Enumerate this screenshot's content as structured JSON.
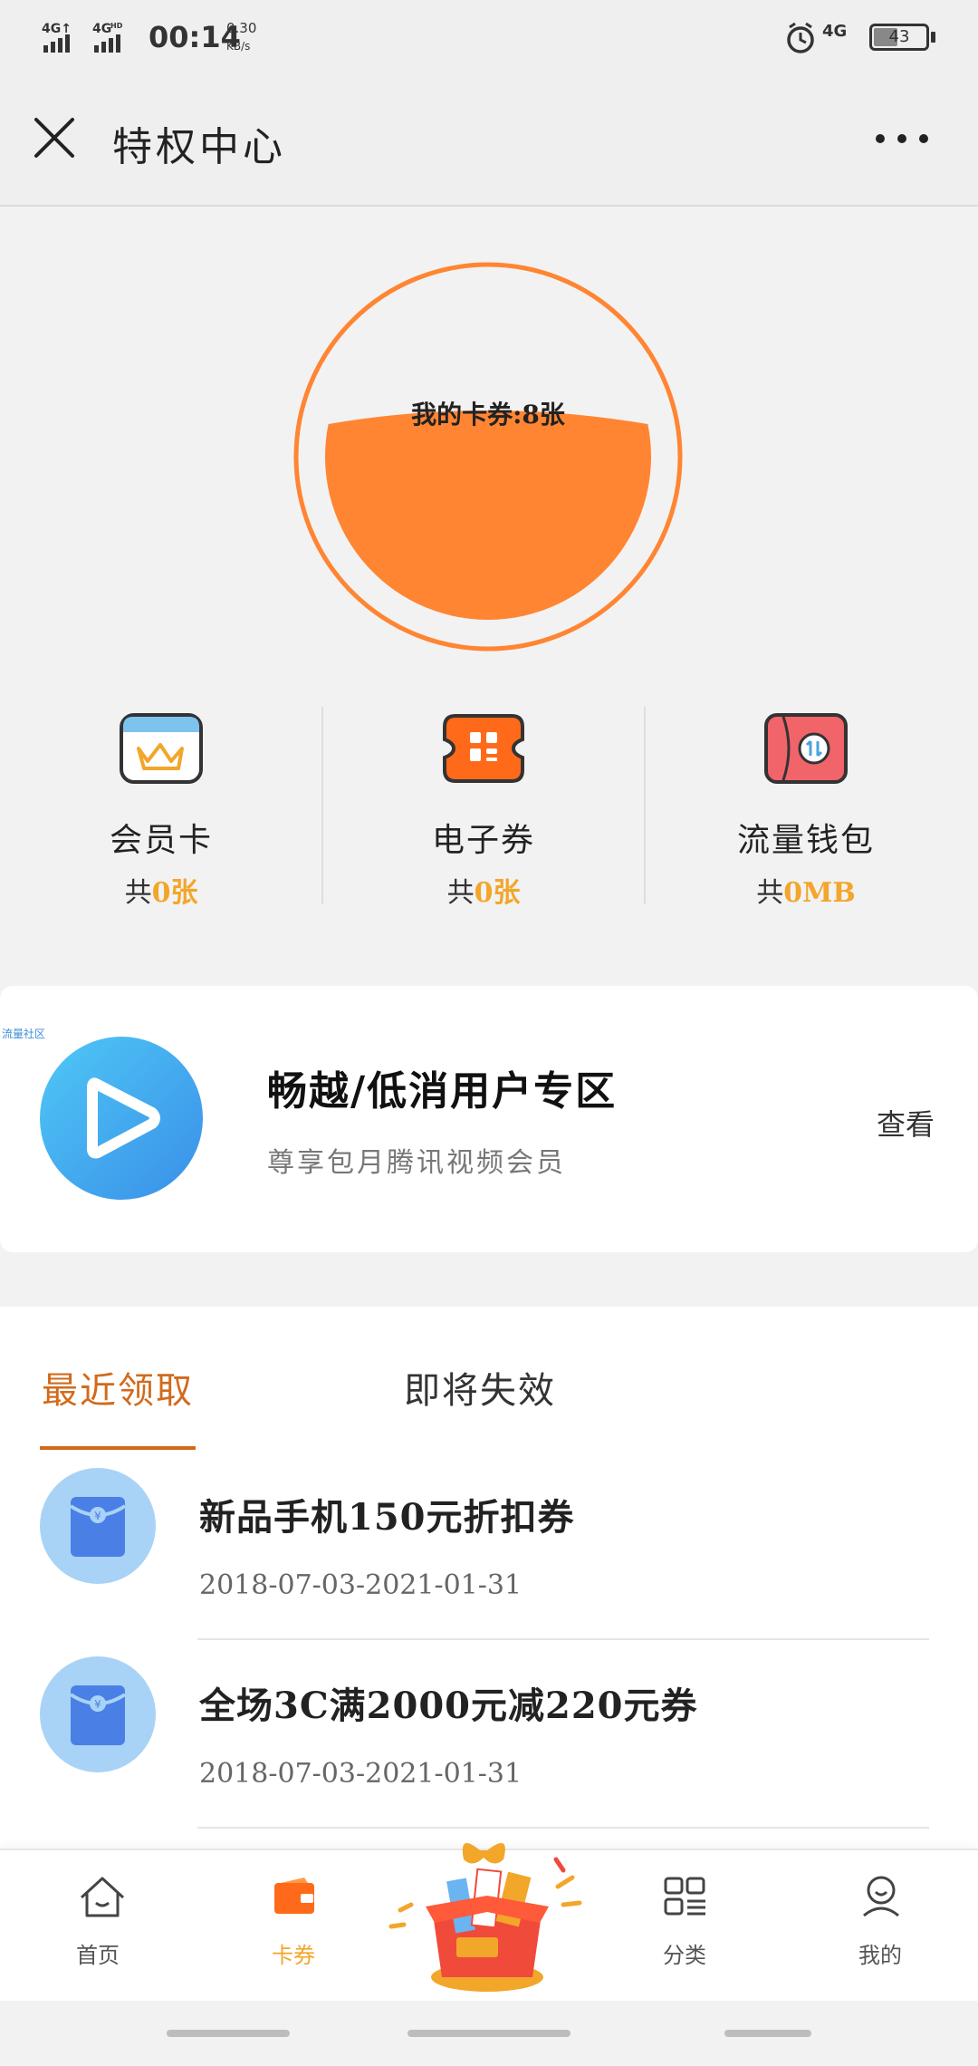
{
  "status": {
    "signal1": "4G",
    "signal2": "4G",
    "signal2_sup": "HD",
    "time": "00:14",
    "speed": "0.30",
    "speed_unit": "KB/s",
    "right_net": "4G",
    "battery": "43"
  },
  "header": {
    "title": "特权中心"
  },
  "summary": {
    "text": "我的卡券:8张",
    "fill_fraction": 0.6,
    "accent": "#ff8533"
  },
  "stats": [
    {
      "name": "会员卡",
      "prefix": "共",
      "value": "0",
      "unit": "张",
      "icon": "crown-card-icon"
    },
    {
      "name": "电子券",
      "prefix": "共",
      "value": "0",
      "unit": "张",
      "icon": "ticket-icon"
    },
    {
      "name": "流量钱包",
      "prefix": "共",
      "value": "0MB",
      "unit": "",
      "icon": "data-wallet-icon"
    }
  ],
  "banner": {
    "tag": "流量社区",
    "title": "畅越/低消用户专区",
    "subtitle": "尊享包月腾讯视频会员",
    "action": "查看",
    "icon": "video-play-icon"
  },
  "tabs": [
    {
      "label": "最近领取",
      "active": true
    },
    {
      "label": "即将失效",
      "active": false
    }
  ],
  "coupons": [
    {
      "title": "新品手机150元折扣券",
      "date": "2018-07-03-2021-01-31"
    },
    {
      "title": "全场3C满2000元减220元券",
      "date": "2018-07-03-2021-01-31"
    }
  ],
  "nav": [
    {
      "label": "首页",
      "icon": "home-icon",
      "active": false
    },
    {
      "label": "卡券",
      "icon": "wallet-icon",
      "active": true
    },
    {
      "label": "",
      "icon": "gift-box-icon",
      "active": false
    },
    {
      "label": "分类",
      "icon": "category-icon",
      "active": false
    },
    {
      "label": "我的",
      "icon": "profile-icon",
      "active": false
    }
  ],
  "colors": {
    "orange": "#ff8533",
    "gold": "#f2a62a",
    "tab_active": "#d26a1c",
    "blue_icon": "#a9d3f6"
  }
}
